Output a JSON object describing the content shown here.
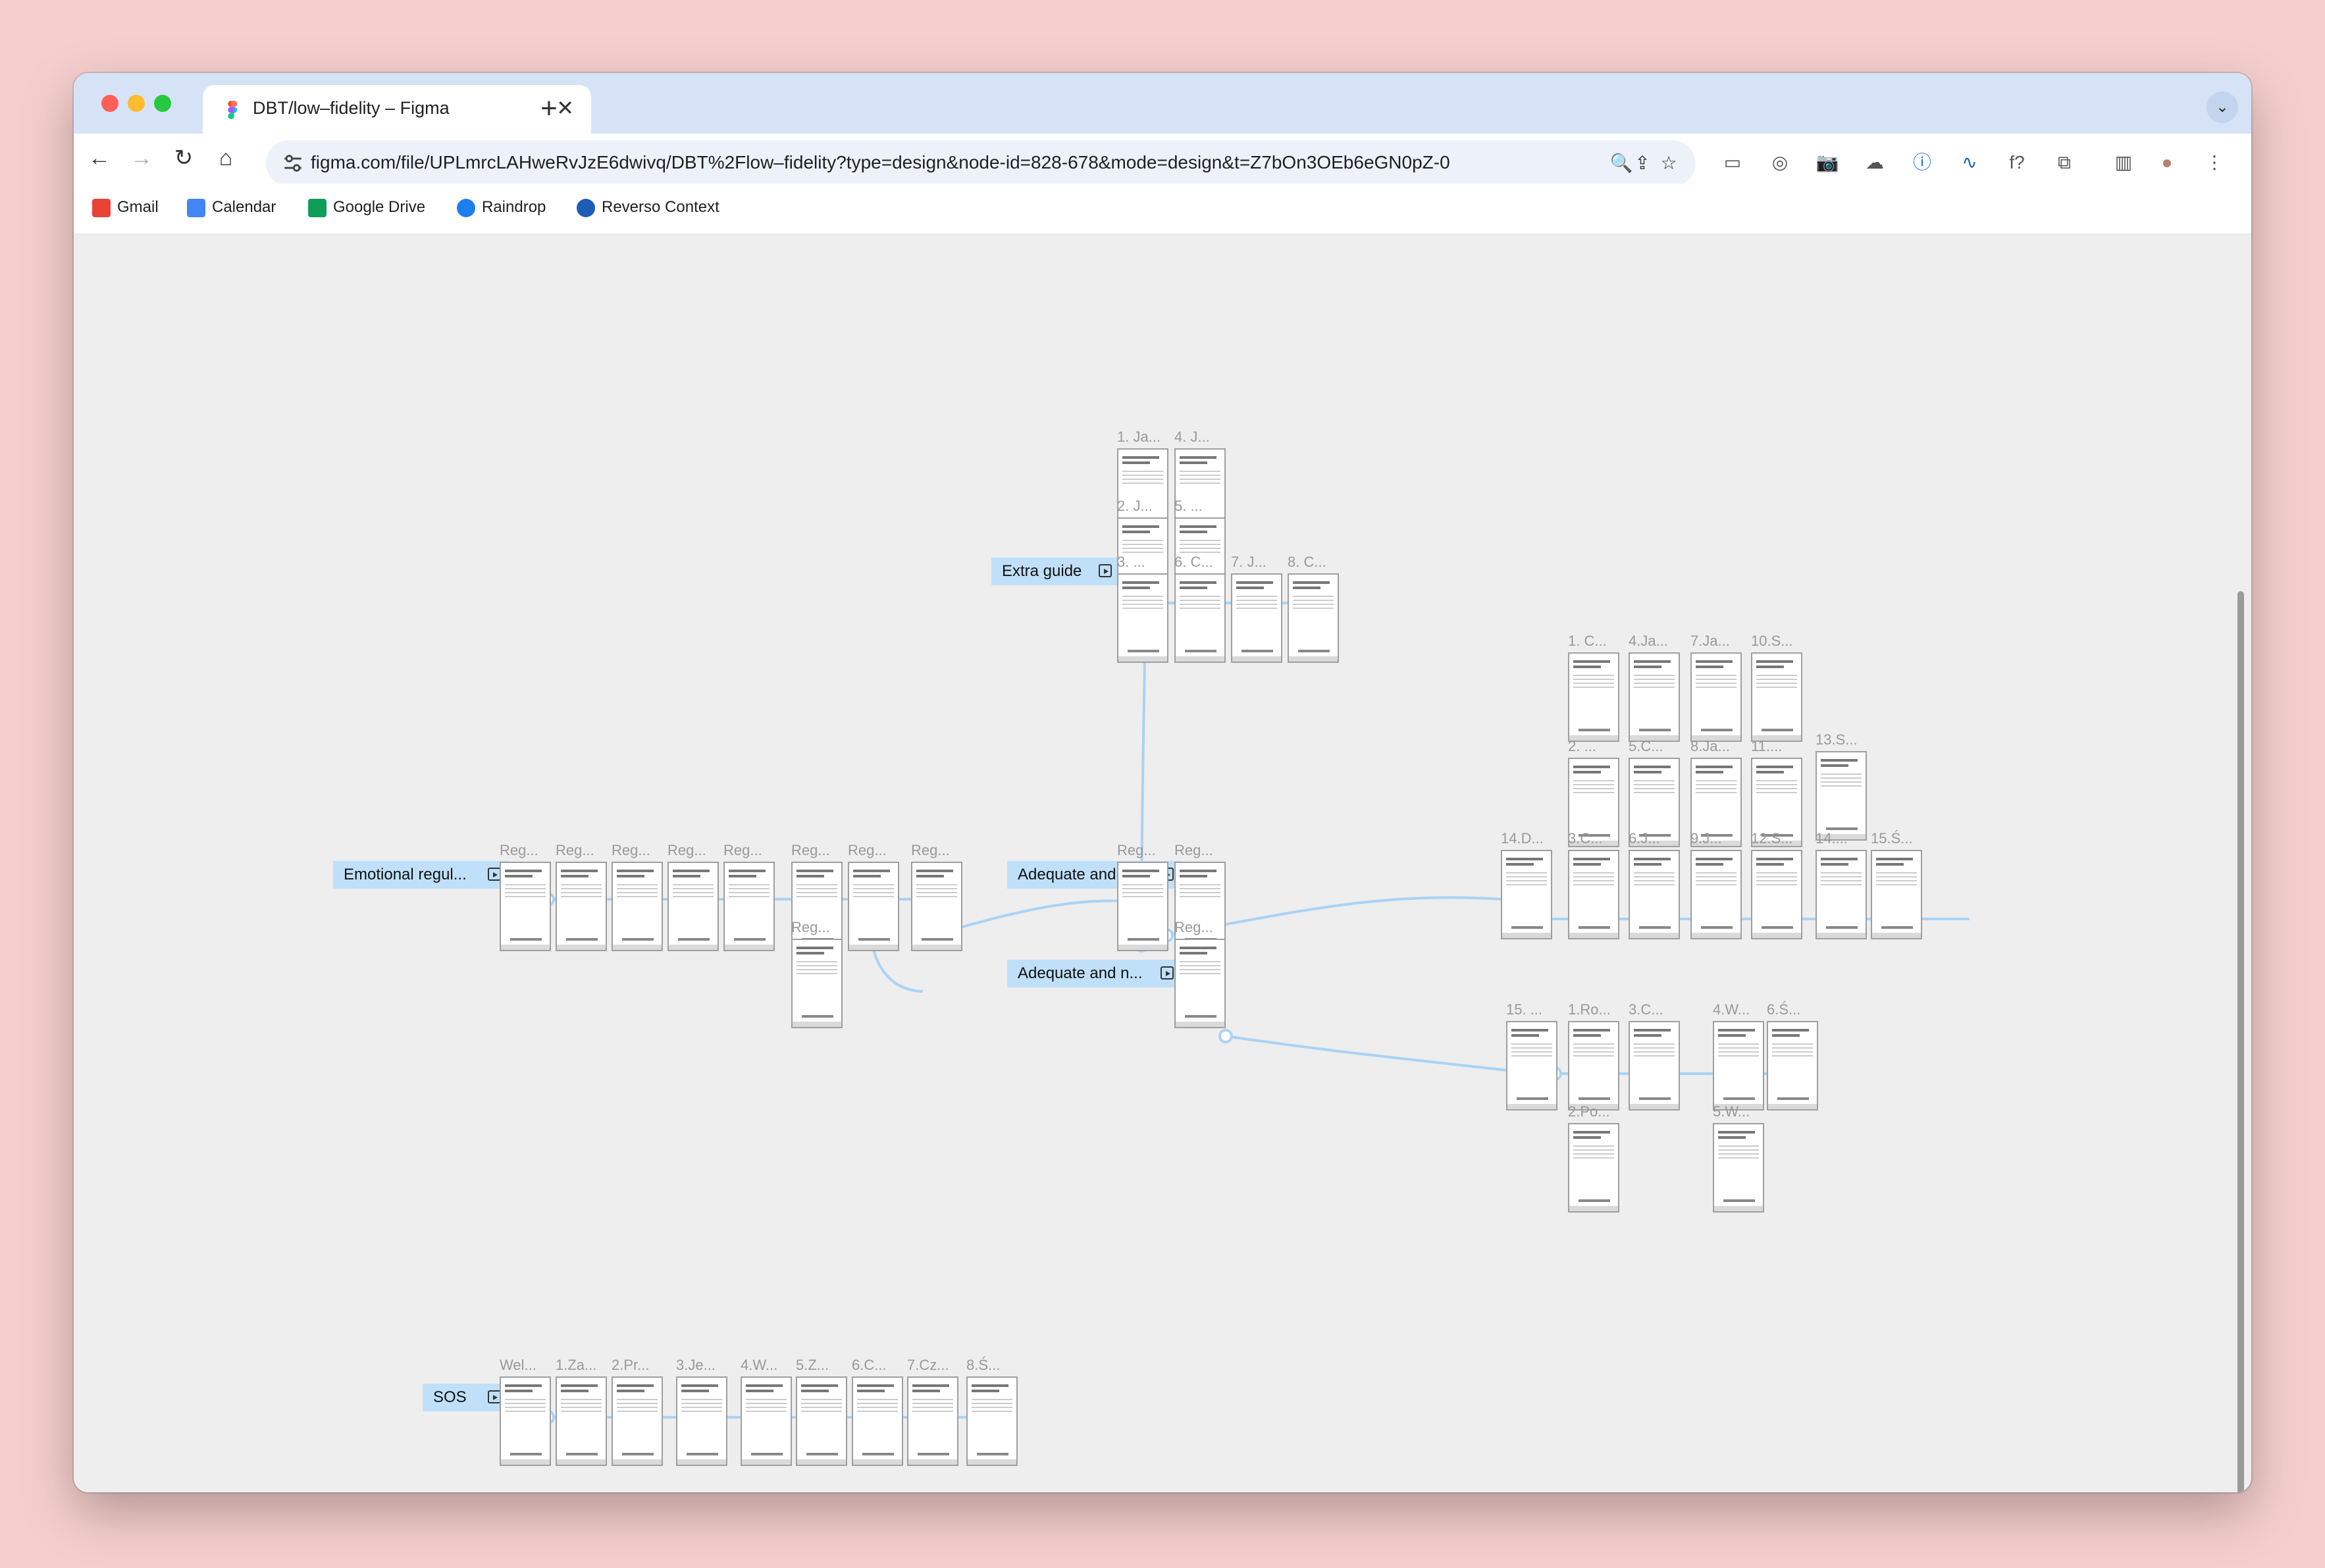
{
  "browser": {
    "tab_title": "DBT/low–fidelity – Figma",
    "tab_close": "✕",
    "new_tab": "+",
    "tab_menu": "⌄",
    "back": "←",
    "forward": "→",
    "reload": "↻",
    "home": "⌂",
    "url": "figma.com/file/UPLmrcLAHweRvJzE6dwivq/DBT%2Flow–fidelity?type=design&node-id=828-678&mode=design&t=Z7bOn3OEb6eGN0pZ-0",
    "omnibox_icons": [
      "🔍",
      "⇪",
      "☆"
    ],
    "extension_icons": [
      "▭",
      "◎",
      "📷",
      "☁",
      "ⓘ",
      "∿",
      "f?",
      "⧉",
      "▥",
      "●",
      "⋮"
    ],
    "bookmarks": [
      {
        "label": "Gmail",
        "color": "#ea4335"
      },
      {
        "label": "Calendar",
        "color": "#4285f4"
      },
      {
        "label": "Google Drive",
        "color": "#0f9d58"
      },
      {
        "label": "Raindrop",
        "color": "#1d7ef0"
      },
      {
        "label": "Reverso Context",
        "color": "#1c5db5"
      }
    ]
  },
  "flows": [
    {
      "label": "Extra guide"
    },
    {
      "label": "Emotional regul..."
    },
    {
      "label": "Adequate and e..."
    },
    {
      "label": "Adequate and n..."
    },
    {
      "label": "SOS"
    }
  ],
  "frame_labels": [
    "1. Ja...",
    "4. J...",
    "2. J...",
    "5. ...",
    "3. ...",
    "6. C...",
    "7. J...",
    "8. C...",
    "Reg...",
    "Reg...",
    "Reg...",
    "Reg...",
    "Reg...",
    "Reg...",
    "Reg...",
    "Reg...",
    "Reg...",
    "Reg...",
    "Reg...",
    "Reg...",
    "1. C...",
    "4.Ja...",
    "7.Ja...",
    "10.S...",
    "2. ...",
    "5.C...",
    "8.Ja...",
    "11....",
    "13.S...",
    "14.D...",
    "3.C...",
    "6.J...",
    "9.J...",
    "12.S...",
    "14....",
    "15.Ś...",
    "15. ...",
    "1.Ro...",
    "3.C...",
    "4.W...",
    "6.Ś...",
    "2.Po...",
    "5.W...",
    "Wel...",
    "1.Za...",
    "2.Pr...",
    "3.Je...",
    "4.W...",
    "5.Z...",
    "6.C...",
    "7.Cz...",
    "8.Ś..."
  ],
  "colors": {
    "canvas": "#eeeeee",
    "flow_label": "#bfe0f8",
    "connector": "#a9d3f5",
    "desktop": "#f5cfcd"
  }
}
